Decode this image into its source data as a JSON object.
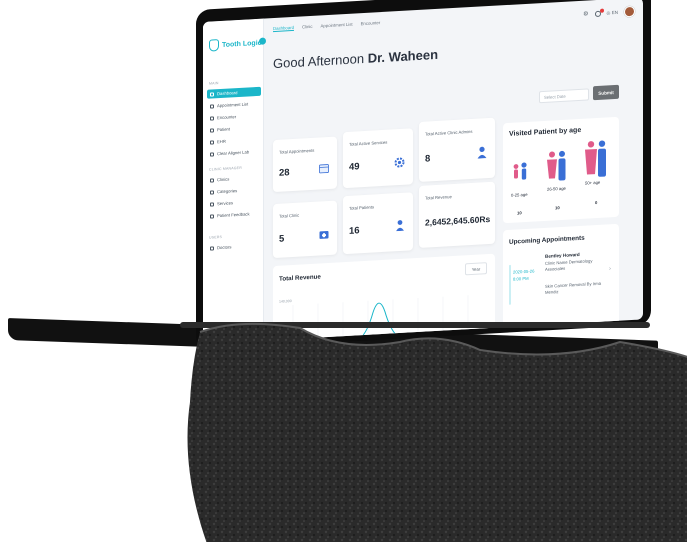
{
  "app": {
    "name": "Tooth Logic"
  },
  "nav": {
    "tabs": [
      "Dashboard",
      "Clinic",
      "Appointment List",
      "Encounter"
    ]
  },
  "header": {
    "lang": "EN"
  },
  "greeting": {
    "prefix": "Good Afternoon",
    "name": "Dr. Waheen"
  },
  "filters": {
    "date_placeholder": "Select Date",
    "submit_label": "Submit"
  },
  "sidebar": {
    "main_label": "MAIN",
    "main_items": [
      "Dashboard",
      "Appointment List",
      "Encounter",
      "Patient",
      "EHR",
      "Clear Aligner Lab"
    ],
    "clinic_label": "CLINIC MANAGER",
    "clinic_items": [
      "Clinics",
      "Categories",
      "Services",
      "Patient Feedback"
    ],
    "users_label": "USERS",
    "users_items": [
      "Doctors"
    ]
  },
  "stats": {
    "total_appointments": {
      "label": "Total Appointments",
      "value": "28"
    },
    "total_active_services": {
      "label": "Total Active Services",
      "value": "49"
    },
    "total_active_clinic_admins": {
      "label": "Total Active Clinic Admins",
      "value": "8"
    },
    "total_clinic": {
      "label": "Total Clinic",
      "value": "5"
    },
    "total_patients": {
      "label": "Total Patients",
      "value": "16"
    },
    "total_revenue": {
      "label": "Total Revenue",
      "value": "2,6452,645.60Rs"
    }
  },
  "visited_by_age": {
    "title": "Visited Patient by age",
    "groups": [
      {
        "label": "0-25 age",
        "count": "10"
      },
      {
        "label": "26-50 age",
        "count": "10"
      },
      {
        "label": "50+ age",
        "count": "0"
      }
    ]
  },
  "revenue_chart": {
    "title": "Total Revenue",
    "period": "Year",
    "y_tick": "140,000"
  },
  "upcoming": {
    "title": "Upcoming Appointments",
    "item": {
      "date": "2020-05-26",
      "time": "8:00 PM",
      "doctor": "Bentley Howard",
      "clinic": "Clinic Name Dermatology Associates",
      "procedure": "Skin Cancer Removal By Irma Mendiz"
    }
  },
  "colors": {
    "accent": "#1bb6c9",
    "male": "#3a6fd6",
    "female": "#e05b8a"
  }
}
